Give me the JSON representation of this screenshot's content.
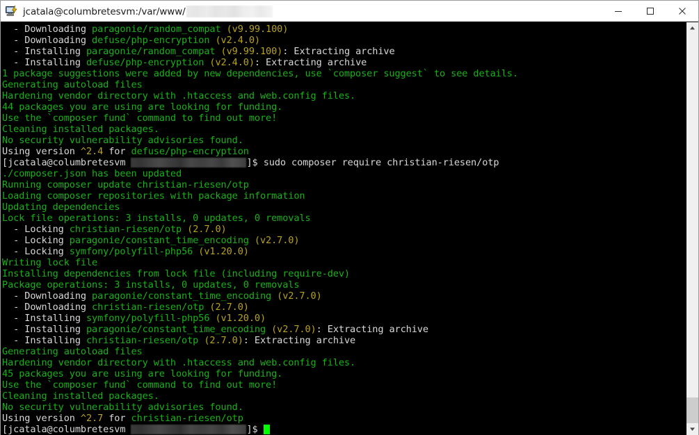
{
  "window": {
    "title_prefix": "jcatala@columbretesvm:/var/www/",
    "title_redacted": true,
    "icon": "putty-icon",
    "controls": {
      "minimize": "minimize-button",
      "maximize": "maximize-button",
      "close": "close-button"
    }
  },
  "colors": {
    "background": "#000000",
    "green": "#18b218",
    "white": "#d8d8d8",
    "yellow": "#b8a317",
    "cursor": "#00ff00",
    "titlebar": "#ffffff",
    "scrollbar_track": "#f0f0f0",
    "scrollbar_thumb": "#cdcdcd"
  },
  "terminal": {
    "prompt_user_host": "[jcatala@columbretesvm",
    "prompt_close": "]$ ",
    "command_1": "sudo composer require christian-riesen/otp",
    "lines": [
      [
        {
          "t": "  - Downloading ",
          "c": "w"
        },
        {
          "t": "paragonie/random_compat",
          "c": "g"
        },
        {
          "t": " ",
          "c": "w"
        },
        {
          "t": "(v9.99.100)",
          "c": "y"
        }
      ],
      [
        {
          "t": "  - Downloading ",
          "c": "w"
        },
        {
          "t": "defuse/php-encryption",
          "c": "g"
        },
        {
          "t": " ",
          "c": "w"
        },
        {
          "t": "(v2.4.0)",
          "c": "y"
        }
      ],
      [
        {
          "t": "  - Installing ",
          "c": "w"
        },
        {
          "t": "paragonie/random_compat",
          "c": "g"
        },
        {
          "t": " ",
          "c": "w"
        },
        {
          "t": "(v9.99.100)",
          "c": "y"
        },
        {
          "t": ": Extracting archive",
          "c": "w"
        }
      ],
      [
        {
          "t": "  - Installing ",
          "c": "w"
        },
        {
          "t": "defuse/php-encryption",
          "c": "g"
        },
        {
          "t": " ",
          "c": "w"
        },
        {
          "t": "(v2.4.0)",
          "c": "y"
        },
        {
          "t": ": Extracting archive",
          "c": "w"
        }
      ],
      [
        {
          "t": "1 package suggestions were added by new dependencies, use `composer suggest` to see details.",
          "c": "g"
        }
      ],
      [
        {
          "t": "Generating autoload files",
          "c": "g"
        }
      ],
      [
        {
          "t": "Hardening vendor directory with .htaccess and web.config files.",
          "c": "g"
        }
      ],
      [
        {
          "t": "44 packages you are using are looking for funding.",
          "c": "g"
        }
      ],
      [
        {
          "t": "Use the `composer fund` command to find out more!",
          "c": "g"
        }
      ],
      [
        {
          "t": "Cleaning installed packages.",
          "c": "g"
        }
      ],
      [
        {
          "t": "No security vulnerability advisories found.",
          "c": "g"
        }
      ],
      [
        {
          "t": "Using version ",
          "c": "w"
        },
        {
          "t": "^2.4",
          "c": "y"
        },
        {
          "t": " for ",
          "c": "w"
        },
        {
          "t": "defuse/php-encryption",
          "c": "g"
        }
      ],
      [
        {
          "t": "PROMPT",
          "c": "prompt"
        }
      ],
      [
        {
          "t": "./composer.json has been updated",
          "c": "g"
        }
      ],
      [
        {
          "t": "Running composer update christian-riesen/otp",
          "c": "g"
        }
      ],
      [
        {
          "t": "Loading composer repositories with package information",
          "c": "g"
        }
      ],
      [
        {
          "t": "Updating dependencies",
          "c": "g"
        }
      ],
      [
        {
          "t": "Lock file operations: 3 installs, 0 updates, 0 removals",
          "c": "g"
        }
      ],
      [
        {
          "t": "  - Locking ",
          "c": "w"
        },
        {
          "t": "christian-riesen/otp",
          "c": "g"
        },
        {
          "t": " ",
          "c": "w"
        },
        {
          "t": "(2.7.0)",
          "c": "y"
        }
      ],
      [
        {
          "t": "  - Locking ",
          "c": "w"
        },
        {
          "t": "paragonie/constant_time_encoding",
          "c": "g"
        },
        {
          "t": " ",
          "c": "w"
        },
        {
          "t": "(v2.7.0)",
          "c": "y"
        }
      ],
      [
        {
          "t": "  - Locking ",
          "c": "w"
        },
        {
          "t": "symfony/polyfill-php56",
          "c": "g"
        },
        {
          "t": " ",
          "c": "w"
        },
        {
          "t": "(v1.20.0)",
          "c": "y"
        }
      ],
      [
        {
          "t": "Writing lock file",
          "c": "g"
        }
      ],
      [
        {
          "t": "Installing dependencies from lock file (including require-dev)",
          "c": "g"
        }
      ],
      [
        {
          "t": "Package operations: 3 installs, 0 updates, 0 removals",
          "c": "g"
        }
      ],
      [
        {
          "t": "  - Downloading ",
          "c": "w"
        },
        {
          "t": "paragonie/constant_time_encoding",
          "c": "g"
        },
        {
          "t": " ",
          "c": "w"
        },
        {
          "t": "(v2.7.0)",
          "c": "y"
        }
      ],
      [
        {
          "t": "  - Downloading ",
          "c": "w"
        },
        {
          "t": "christian-riesen/otp",
          "c": "g"
        },
        {
          "t": " ",
          "c": "w"
        },
        {
          "t": "(2.7.0)",
          "c": "y"
        }
      ],
      [
        {
          "t": "  - Installing ",
          "c": "w"
        },
        {
          "t": "symfony/polyfill-php56",
          "c": "g"
        },
        {
          "t": " ",
          "c": "w"
        },
        {
          "t": "(v1.20.0)",
          "c": "y"
        }
      ],
      [
        {
          "t": "  - Installing ",
          "c": "w"
        },
        {
          "t": "paragonie/constant_time_encoding",
          "c": "g"
        },
        {
          "t": " ",
          "c": "w"
        },
        {
          "t": "(v2.7.0)",
          "c": "y"
        },
        {
          "t": ": Extracting archive",
          "c": "w"
        }
      ],
      [
        {
          "t": "  - Installing ",
          "c": "w"
        },
        {
          "t": "christian-riesen/otp",
          "c": "g"
        },
        {
          "t": " ",
          "c": "w"
        },
        {
          "t": "(2.7.0)",
          "c": "y"
        },
        {
          "t": ": Extracting archive",
          "c": "w"
        }
      ],
      [
        {
          "t": "Generating autoload files",
          "c": "g"
        }
      ],
      [
        {
          "t": "Hardening vendor directory with .htaccess and web.config files.",
          "c": "g"
        }
      ],
      [
        {
          "t": "45 packages you are using are looking for funding.",
          "c": "g"
        }
      ],
      [
        {
          "t": "Use the `composer fund` command to find out more!",
          "c": "g"
        }
      ],
      [
        {
          "t": "Cleaning installed packages.",
          "c": "g"
        }
      ],
      [
        {
          "t": "No security vulnerability advisories found.",
          "c": "g"
        }
      ],
      [
        {
          "t": "Using version ",
          "c": "w"
        },
        {
          "t": "^2.7",
          "c": "y"
        },
        {
          "t": " for ",
          "c": "w"
        },
        {
          "t": "christian-riesen/otp",
          "c": "g"
        }
      ],
      [
        {
          "t": "PROMPT_CURSOR",
          "c": "prompt"
        }
      ]
    ]
  },
  "scrollbar": {
    "up_arrow": "scroll-up-arrow",
    "down_arrow": "scroll-down-arrow",
    "thumb": "scrollbar-thumb"
  }
}
